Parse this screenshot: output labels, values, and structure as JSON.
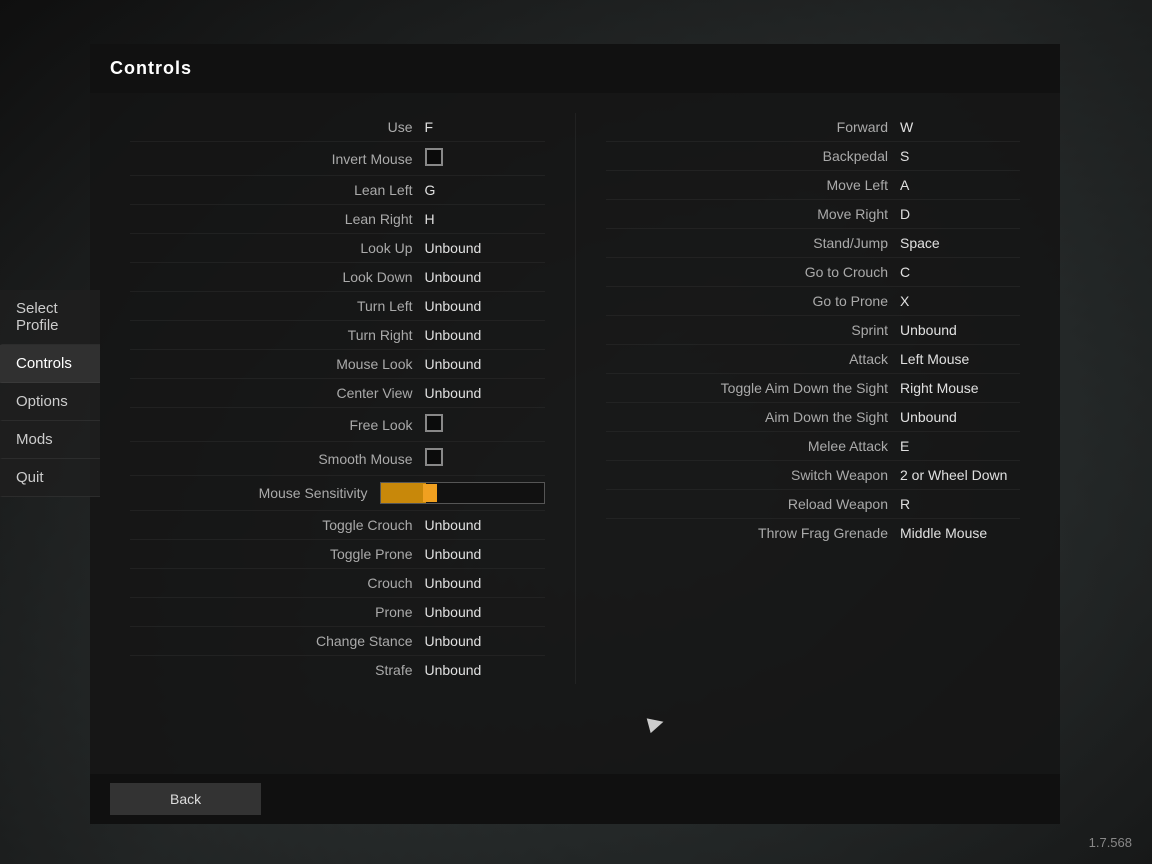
{
  "sidebar": {
    "items": [
      {
        "label": "Select Profile",
        "id": "select-profile",
        "active": false
      },
      {
        "label": "Controls",
        "id": "controls",
        "active": true
      },
      {
        "label": "Options",
        "id": "options",
        "active": false
      },
      {
        "label": "Mods",
        "id": "mods",
        "active": false
      },
      {
        "label": "Quit",
        "id": "quit",
        "active": false
      }
    ]
  },
  "panel": {
    "title": "Controls"
  },
  "left_controls": [
    {
      "name": "Use",
      "value": "F",
      "type": "key"
    },
    {
      "name": "Invert Mouse",
      "value": "",
      "type": "checkbox"
    },
    {
      "name": "Lean Left",
      "value": "G",
      "type": "key"
    },
    {
      "name": "Lean Right",
      "value": "H",
      "type": "key"
    },
    {
      "name": "Look Up",
      "value": "Unbound",
      "type": "key"
    },
    {
      "name": "Look Down",
      "value": "Unbound",
      "type": "key"
    },
    {
      "name": "Turn Left",
      "value": "Unbound",
      "type": "key"
    },
    {
      "name": "Turn Right",
      "value": "Unbound",
      "type": "key"
    },
    {
      "name": "Mouse Look",
      "value": "Unbound",
      "type": "key"
    },
    {
      "name": "Center View",
      "value": "Unbound",
      "type": "key"
    },
    {
      "name": "Free Look",
      "value": "",
      "type": "checkbox"
    },
    {
      "name": "Smooth Mouse",
      "value": "",
      "type": "checkbox"
    },
    {
      "name": "Mouse Sensitivity",
      "value": "",
      "type": "slider"
    },
    {
      "name": "Toggle Crouch",
      "value": "Unbound",
      "type": "key"
    },
    {
      "name": "Toggle Prone",
      "value": "Unbound",
      "type": "key"
    },
    {
      "name": "Crouch",
      "value": "Unbound",
      "type": "key"
    },
    {
      "name": "Prone",
      "value": "Unbound",
      "type": "key"
    },
    {
      "name": "Change Stance",
      "value": "Unbound",
      "type": "key"
    },
    {
      "name": "Strafe",
      "value": "Unbound",
      "type": "key"
    }
  ],
  "right_controls": [
    {
      "name": "Forward",
      "value": "W",
      "type": "key"
    },
    {
      "name": "Backpedal",
      "value": "S",
      "type": "key"
    },
    {
      "name": "Move Left",
      "value": "A",
      "type": "key"
    },
    {
      "name": "Move Right",
      "value": "D",
      "type": "key"
    },
    {
      "name": "Stand/Jump",
      "value": "Space",
      "type": "key"
    },
    {
      "name": "Go to Crouch",
      "value": "C",
      "type": "key"
    },
    {
      "name": "Go to Prone",
      "value": "X",
      "type": "key"
    },
    {
      "name": "Sprint",
      "value": "Unbound",
      "type": "key"
    },
    {
      "name": "Attack",
      "value": "Left Mouse",
      "type": "key"
    },
    {
      "name": "Toggle Aim Down the Sight",
      "value": "Right Mouse",
      "type": "key"
    },
    {
      "name": "Aim Down the Sight",
      "value": "Unbound",
      "type": "key"
    },
    {
      "name": "Melee Attack",
      "value": "E",
      "type": "key"
    },
    {
      "name": "Switch Weapon",
      "value": "2 or Wheel Down",
      "type": "key"
    },
    {
      "name": "Reload Weapon",
      "value": "R",
      "type": "key"
    },
    {
      "name": "Throw Frag Grenade",
      "value": "Middle Mouse",
      "type": "key"
    }
  ],
  "footer": {
    "back_label": "Back",
    "version": "1.7.568"
  }
}
